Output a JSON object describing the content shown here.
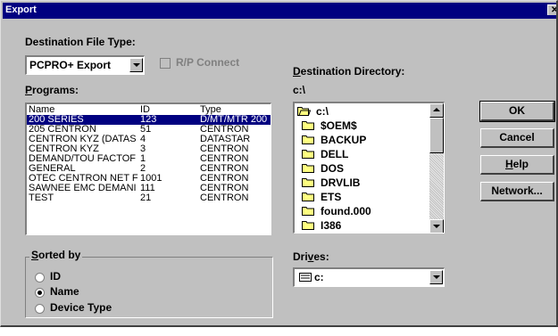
{
  "window": {
    "title": "Export",
    "close_glyph": "✕"
  },
  "destination_type": {
    "label": "Destination File Type:",
    "value": "PCPRO+ Export"
  },
  "rp_connect": {
    "label": "R/P Connect",
    "checked": false,
    "enabled": false
  },
  "programs": {
    "label": "Programs:",
    "columns": [
      "Name",
      "ID",
      "Type"
    ],
    "rows": [
      {
        "name": "200 SERIES",
        "id": "123",
        "type": "D/MT/MTR 200",
        "selected": true
      },
      {
        "name": "205 CENTRON",
        "id": "51",
        "type": "CENTRON"
      },
      {
        "name": "CENTRON KYZ (DATAS",
        "id": "4",
        "type": "DATASTAR"
      },
      {
        "name": "CENTRON KYZ",
        "id": "3",
        "type": "CENTRON"
      },
      {
        "name": "DEMAND/TOU FACTOF",
        "id": "1",
        "type": "CENTRON"
      },
      {
        "name": "GENERAL",
        "id": "2",
        "type": "CENTRON"
      },
      {
        "name": "OTEC CENTRON NET F",
        "id": "1001",
        "type": "CENTRON"
      },
      {
        "name": "SAWNEE EMC DEMANI",
        "id": "111",
        "type": "CENTRON"
      },
      {
        "name": "TEST",
        "id": "21",
        "type": "CENTRON"
      }
    ]
  },
  "sorted_by": {
    "label": "Sorted by",
    "options": [
      {
        "label": "ID",
        "selected": false
      },
      {
        "label": "Name",
        "selected": true
      },
      {
        "label": "Device Type",
        "selected": false
      }
    ]
  },
  "destination_dir": {
    "label": "Destination Directory:",
    "path": "c:\\",
    "items": [
      {
        "name": "c:\\",
        "icon": "open-folder-icon"
      },
      {
        "name": "$OEM$",
        "icon": "folder-icon"
      },
      {
        "name": "BACKUP",
        "icon": "folder-icon"
      },
      {
        "name": "DELL",
        "icon": "folder-icon"
      },
      {
        "name": "DOS",
        "icon": "folder-icon"
      },
      {
        "name": "DRVLIB",
        "icon": "folder-icon"
      },
      {
        "name": "ETS",
        "icon": "folder-icon"
      },
      {
        "name": "found.000",
        "icon": "folder-icon"
      },
      {
        "name": "I386",
        "icon": "folder-icon"
      }
    ]
  },
  "drives": {
    "label": "Drives:",
    "value": "c:",
    "icon": "drive-icon"
  },
  "buttons": {
    "ok": "OK",
    "cancel": "Cancel",
    "help": "Help",
    "network": "Network..."
  }
}
